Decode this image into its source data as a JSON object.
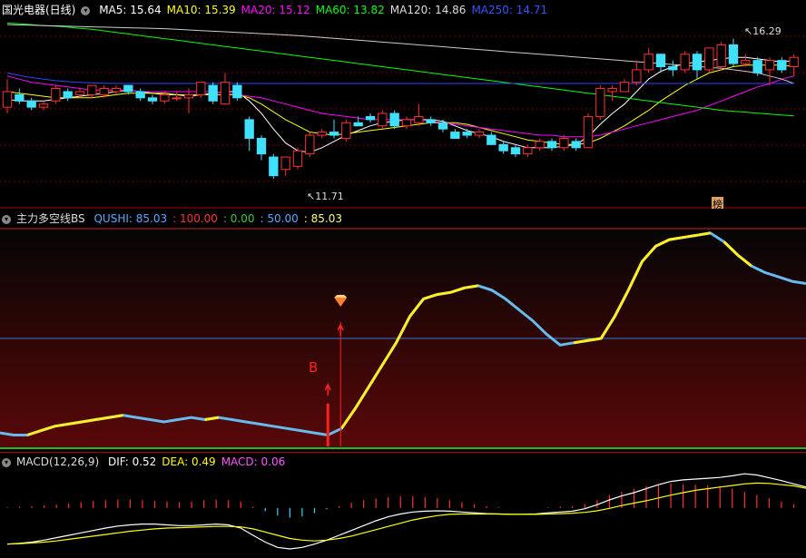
{
  "main": {
    "title": "国光电器(日线)",
    "ma": [
      {
        "label": "MA5: 15.64",
        "color": "#ffffff"
      },
      {
        "label": "MA10: 15.39",
        "color": "#ffff00"
      },
      {
        "label": "MA20: 15.12",
        "color": "#ff00ff"
      },
      {
        "label": "MA60: 13.82",
        "color": "#00ff00"
      },
      {
        "label": "MA120: 14.86",
        "color": "#dddddd"
      },
      {
        "label": "MA250: 14.71",
        "color": "#3355ff"
      }
    ],
    "high_label": "16.29",
    "low_label": "11.71",
    "badge": "榜",
    "price_range": [
      10.9,
      16.9
    ],
    "candles": [
      [
        14.1,
        14.6,
        15.0,
        13.9
      ],
      [
        14.5,
        14.3,
        14.7,
        14.2
      ],
      [
        14.3,
        14.1,
        14.4,
        14.0
      ],
      [
        14.1,
        14.2,
        14.3,
        14.0
      ],
      [
        14.3,
        14.7,
        14.8,
        14.2
      ],
      [
        14.6,
        14.4,
        14.7,
        14.3
      ],
      [
        14.5,
        14.6,
        14.7,
        14.4
      ],
      [
        14.5,
        14.8,
        14.8,
        14.4
      ],
      [
        14.5,
        14.7,
        14.8,
        14.4
      ],
      [
        14.6,
        14.7,
        14.8,
        14.5
      ],
      [
        14.8,
        14.6,
        14.8,
        14.5
      ],
      [
        14.6,
        14.4,
        14.7,
        14.3
      ],
      [
        14.4,
        14.3,
        14.5,
        14.2
      ],
      [
        14.3,
        14.5,
        14.6,
        14.2
      ],
      [
        14.4,
        14.4,
        14.6,
        14.3
      ],
      [
        14.4,
        14.5,
        14.7,
        13.9
      ],
      [
        14.5,
        14.9,
        14.9,
        14.4
      ],
      [
        14.8,
        14.3,
        14.9,
        14.2
      ],
      [
        14.2,
        14.9,
        15.2,
        14.2
      ],
      [
        14.8,
        14.4,
        14.9,
        14.3
      ],
      [
        13.7,
        13.1,
        13.8,
        12.7
      ],
      [
        13.1,
        12.6,
        13.2,
        12.4
      ],
      [
        12.5,
        11.9,
        12.6,
        11.8
      ],
      [
        12.1,
        12.5,
        12.5,
        11.9
      ],
      [
        12.2,
        12.7,
        12.8,
        12.1
      ],
      [
        12.6,
        13.2,
        13.3,
        12.5
      ],
      [
        13.2,
        13.3,
        13.4,
        13.1
      ],
      [
        13.3,
        13.2,
        13.7,
        13.1
      ],
      [
        13.1,
        13.6,
        13.7,
        13.0
      ],
      [
        13.6,
        13.5,
        13.8,
        13.5
      ],
      [
        13.8,
        13.7,
        13.9,
        13.6
      ],
      [
        13.5,
        13.9,
        14.0,
        13.4
      ],
      [
        13.9,
        13.5,
        14.0,
        13.4
      ],
      [
        13.5,
        13.7,
        13.8,
        13.4
      ],
      [
        13.6,
        13.8,
        14.2,
        13.5
      ],
      [
        13.7,
        13.6,
        13.8,
        13.5
      ],
      [
        13.6,
        13.4,
        13.7,
        13.3
      ],
      [
        13.3,
        13.1,
        13.4,
        13.1
      ],
      [
        13.3,
        13.2,
        13.4,
        13.1
      ],
      [
        13.2,
        13.3,
        13.4,
        13.1
      ],
      [
        13.2,
        12.9,
        13.3,
        12.9
      ],
      [
        12.9,
        12.7,
        13.0,
        12.6
      ],
      [
        12.8,
        12.6,
        12.9,
        12.5
      ],
      [
        12.6,
        12.8,
        12.9,
        12.5
      ],
      [
        12.8,
        13.0,
        13.1,
        12.7
      ],
      [
        13.0,
        12.8,
        13.1,
        12.7
      ],
      [
        12.8,
        13.1,
        13.2,
        12.7
      ],
      [
        13.0,
        12.8,
        13.1,
        12.7
      ],
      [
        12.8,
        13.8,
        13.9,
        12.8
      ],
      [
        13.8,
        14.7,
        14.8,
        13.7
      ],
      [
        14.6,
        14.7,
        14.8,
        14.3
      ],
      [
        14.6,
        14.9,
        15.0,
        14.6
      ],
      [
        14.9,
        15.3,
        15.6,
        14.8
      ],
      [
        15.3,
        15.8,
        16.0,
        15.2
      ],
      [
        15.8,
        15.4,
        15.8,
        15.2
      ],
      [
        15.4,
        15.3,
        15.6,
        15.1
      ],
      [
        15.3,
        15.8,
        15.9,
        15.2
      ],
      [
        15.8,
        15.3,
        15.9,
        15.0
      ],
      [
        15.3,
        16.0,
        16.0,
        15.2
      ],
      [
        15.4,
        16.1,
        16.2,
        15.3
      ],
      [
        16.1,
        15.5,
        16.3,
        15.4
      ],
      [
        15.5,
        15.6,
        15.8,
        15.4
      ],
      [
        15.6,
        15.2,
        15.7,
        15.1
      ],
      [
        15.3,
        15.6,
        15.7,
        14.8
      ],
      [
        15.6,
        15.3,
        15.7,
        15.2
      ],
      [
        15.4,
        15.7,
        15.8,
        15.1
      ]
    ],
    "ma_lines": [
      {
        "color": "#ffffff",
        "values": [
          14.35,
          14.3,
          14.3,
          14.3,
          14.35,
          14.4,
          14.45,
          14.5,
          14.55,
          14.6,
          14.65,
          14.6,
          14.55,
          14.5,
          14.5,
          14.45,
          14.5,
          14.55,
          14.6,
          14.6,
          14.3,
          13.9,
          13.4,
          12.95,
          12.7,
          12.65,
          12.8,
          13.0,
          13.2,
          13.35,
          13.5,
          13.6,
          13.65,
          13.7,
          13.7,
          13.7,
          13.65,
          13.5,
          13.35,
          13.25,
          13.15,
          13.0,
          12.9,
          12.8,
          12.8,
          12.8,
          12.85,
          12.9,
          13.15,
          13.55,
          13.9,
          14.2,
          14.6,
          15.0,
          15.25,
          15.4,
          15.5,
          15.55,
          15.6,
          15.65,
          15.7,
          15.7,
          15.65,
          15.6,
          15.55,
          15.6
        ]
      },
      {
        "color": "#ffff00",
        "values": [
          14.6,
          14.55,
          14.5,
          14.45,
          14.4,
          14.4,
          14.4,
          14.4,
          14.45,
          14.5,
          14.55,
          14.55,
          14.55,
          14.55,
          14.5,
          14.5,
          14.5,
          14.5,
          14.5,
          14.5,
          14.4,
          14.2,
          13.95,
          13.7,
          13.5,
          13.3,
          13.25,
          13.2,
          13.25,
          13.3,
          13.35,
          13.4,
          13.45,
          13.5,
          13.55,
          13.6,
          13.6,
          13.6,
          13.55,
          13.45,
          13.35,
          13.25,
          13.15,
          13.05,
          13.0,
          12.95,
          12.9,
          12.9,
          12.95,
          13.1,
          13.3,
          13.5,
          13.75,
          14.0,
          14.3,
          14.55,
          14.8,
          15.0,
          15.2,
          15.3,
          15.4,
          15.45,
          15.45,
          15.45,
          15.45,
          15.4
        ]
      },
      {
        "color": "#ff00ff",
        "values": [
          15.1,
          15.0,
          14.9,
          14.85,
          14.8,
          14.75,
          14.7,
          14.65,
          14.65,
          14.65,
          14.65,
          14.6,
          14.6,
          14.6,
          14.6,
          14.6,
          14.6,
          14.6,
          14.55,
          14.5,
          14.45,
          14.4,
          14.3,
          14.2,
          14.1,
          14.0,
          13.9,
          13.85,
          13.8,
          13.75,
          13.7,
          13.7,
          13.7,
          13.7,
          13.7,
          13.65,
          13.6,
          13.55,
          13.5,
          13.45,
          13.4,
          13.35,
          13.3,
          13.25,
          13.2,
          13.2,
          13.15,
          13.15,
          13.15,
          13.2,
          13.3,
          13.4,
          13.5,
          13.6,
          13.7,
          13.8,
          13.9,
          14.0,
          14.15,
          14.3,
          14.45,
          14.6,
          14.75,
          14.85,
          15.0,
          15.1
        ]
      },
      {
        "color": "#00ff00",
        "values": [
          16.8,
          16.78,
          16.75,
          16.72,
          16.7,
          16.67,
          16.63,
          16.6,
          16.55,
          16.5,
          16.45,
          16.4,
          16.35,
          16.3,
          16.25,
          16.2,
          16.15,
          16.1,
          16.05,
          16.0,
          15.95,
          15.9,
          15.85,
          15.8,
          15.75,
          15.7,
          15.65,
          15.6,
          15.55,
          15.5,
          15.45,
          15.4,
          15.35,
          15.3,
          15.25,
          15.2,
          15.15,
          15.1,
          15.05,
          15.0,
          14.95,
          14.9,
          14.85,
          14.8,
          14.75,
          14.7,
          14.65,
          14.6,
          14.55,
          14.5,
          14.45,
          14.4,
          14.35,
          14.3,
          14.25,
          14.2,
          14.15,
          14.1,
          14.05,
          14.0,
          13.97,
          13.94,
          13.91,
          13.88,
          13.85,
          13.82
        ]
      },
      {
        "color": "#cccccc",
        "values": [
          16.75,
          16.74,
          16.73,
          16.72,
          16.71,
          16.7,
          16.69,
          16.68,
          16.67,
          16.66,
          16.65,
          16.64,
          16.63,
          16.62,
          16.6,
          16.58,
          16.56,
          16.54,
          16.52,
          16.5,
          16.48,
          16.46,
          16.44,
          16.42,
          16.4,
          16.37,
          16.34,
          16.31,
          16.28,
          16.25,
          16.22,
          16.19,
          16.16,
          16.13,
          16.1,
          16.07,
          16.04,
          16.01,
          15.98,
          15.95,
          15.92,
          15.89,
          15.86,
          15.83,
          15.8,
          15.77,
          15.74,
          15.71,
          15.68,
          15.65,
          15.62,
          15.59,
          15.56,
          15.53,
          15.5,
          15.47,
          15.44,
          15.41,
          15.38,
          15.35,
          15.3,
          15.25,
          15.2,
          15.1,
          15.0,
          14.86
        ]
      },
      {
        "color": "#3344ff",
        "values": [
          15.2,
          15.12,
          15.05,
          15.0,
          14.95,
          14.92,
          14.9,
          14.88,
          14.87,
          14.86,
          14.86,
          14.86,
          14.86,
          14.86,
          14.86,
          14.86,
          14.86,
          14.86,
          14.86,
          14.86,
          14.86,
          14.86,
          14.86,
          14.86,
          14.86,
          14.86,
          14.86,
          14.86,
          14.86,
          14.86,
          14.86,
          14.86,
          14.86,
          14.86,
          14.86,
          14.86,
          14.86,
          14.86,
          14.86,
          14.86,
          14.86,
          14.86,
          14.86,
          14.86,
          14.86,
          14.86,
          14.86,
          14.86,
          14.86,
          14.86,
          14.86,
          14.86,
          14.86,
          14.86,
          14.86,
          14.86,
          14.86,
          14.86,
          14.86,
          14.86,
          14.86,
          14.86,
          14.86,
          14.86,
          14.86,
          14.86
        ]
      }
    ]
  },
  "indicator": {
    "title": "主力多空线BS",
    "values": [
      {
        "label": "QUSHI: 85.03",
        "color": "#55aaff"
      },
      {
        "label": ": 100.00",
        "color": "#ff3333"
      },
      {
        "label": ": 0.00",
        "color": "#33cc33"
      },
      {
        "label": ": 50.00",
        "color": "#55aaff"
      },
      {
        "label": ": 85.03",
        "color": "#ffff66"
      }
    ],
    "signal_label": "B",
    "range": [
      0,
      100
    ],
    "line": [
      7,
      6,
      6,
      8,
      10,
      11,
      12,
      13,
      14,
      15,
      14,
      13,
      12,
      13,
      14,
      13,
      14,
      13,
      12,
      11,
      10,
      9,
      8,
      7,
      6,
      9,
      18,
      28,
      38,
      48,
      60,
      68,
      70,
      71,
      73,
      74,
      72,
      68,
      63,
      58,
      52,
      47,
      48,
      49,
      50,
      60,
      72,
      85,
      92,
      95,
      96,
      97,
      98,
      94,
      88,
      83,
      80,
      78,
      76,
      75
    ],
    "yellow_segments": [
      [
        2,
        9
      ],
      [
        15,
        16
      ],
      [
        25,
        35
      ],
      [
        42,
        52
      ],
      [
        53,
        55
      ]
    ]
  },
  "macd": {
    "title": "MACD(12,26,9)",
    "values": [
      {
        "label": "DIF: 0.52",
        "color": "#ffffff"
      },
      {
        "label": "DEA: 0.49",
        "color": "#ffff00"
      },
      {
        "label": "MACD: 0.06",
        "color": "#ff55ff"
      }
    ],
    "range": [
      -1.2,
      0.9
    ],
    "hist": [
      0.01,
      0.02,
      0.03,
      0.04,
      0.05,
      0.07,
      0.09,
      0.11,
      0.12,
      0.13,
      0.13,
      0.12,
      0.11,
      0.1,
      0.09,
      0.1,
      0.12,
      0.13,
      0.12,
      0.1,
      0.02,
      -0.05,
      -0.12,
      -0.15,
      -0.13,
      -0.08,
      -0.02,
      0.03,
      0.08,
      0.12,
      0.15,
      0.17,
      0.18,
      0.18,
      0.17,
      0.15,
      0.12,
      0.09,
      0.06,
      0.03,
      0.01,
      0.0,
      0.0,
      0.0,
      0.01,
      0.02,
      0.03,
      0.06,
      0.12,
      0.2,
      0.25,
      0.3,
      0.34,
      0.36,
      0.38,
      0.37,
      0.36,
      0.35,
      0.34,
      0.3,
      0.25,
      0.2,
      0.15,
      0.1,
      0.06
    ],
    "dif": [
      -0.9,
      -0.88,
      -0.85,
      -0.8,
      -0.74,
      -0.68,
      -0.62,
      -0.56,
      -0.5,
      -0.45,
      -0.42,
      -0.4,
      -0.4,
      -0.42,
      -0.44,
      -0.44,
      -0.42,
      -0.4,
      -0.42,
      -0.5,
      -0.68,
      -0.85,
      -0.98,
      -1.02,
      -0.98,
      -0.9,
      -0.8,
      -0.68,
      -0.56,
      -0.44,
      -0.32,
      -0.22,
      -0.15,
      -0.1,
      -0.08,
      -0.07,
      -0.08,
      -0.1,
      -0.12,
      -0.14,
      -0.15,
      -0.16,
      -0.16,
      -0.15,
      -0.12,
      -0.1,
      -0.08,
      -0.02,
      0.08,
      0.2,
      0.3,
      0.38,
      0.48,
      0.58,
      0.66,
      0.7,
      0.72,
      0.74,
      0.76,
      0.8,
      0.85,
      0.82,
      0.75,
      0.68,
      0.6,
      0.52
    ],
    "dea": [
      -0.9,
      -0.89,
      -0.87,
      -0.85,
      -0.82,
      -0.78,
      -0.74,
      -0.7,
      -0.66,
      -0.62,
      -0.58,
      -0.55,
      -0.52,
      -0.5,
      -0.49,
      -0.48,
      -0.47,
      -0.46,
      -0.46,
      -0.47,
      -0.52,
      -0.6,
      -0.68,
      -0.76,
      -0.8,
      -0.82,
      -0.8,
      -0.76,
      -0.7,
      -0.62,
      -0.54,
      -0.46,
      -0.38,
      -0.3,
      -0.24,
      -0.19,
      -0.16,
      -0.15,
      -0.15,
      -0.15,
      -0.15,
      -0.16,
      -0.16,
      -0.16,
      -0.15,
      -0.14,
      -0.13,
      -0.11,
      -0.07,
      -0.01,
      0.06,
      0.12,
      0.18,
      0.25,
      0.32,
      0.38,
      0.44,
      0.48,
      0.52,
      0.56,
      0.6,
      0.62,
      0.61,
      0.58,
      0.55,
      0.49
    ]
  }
}
